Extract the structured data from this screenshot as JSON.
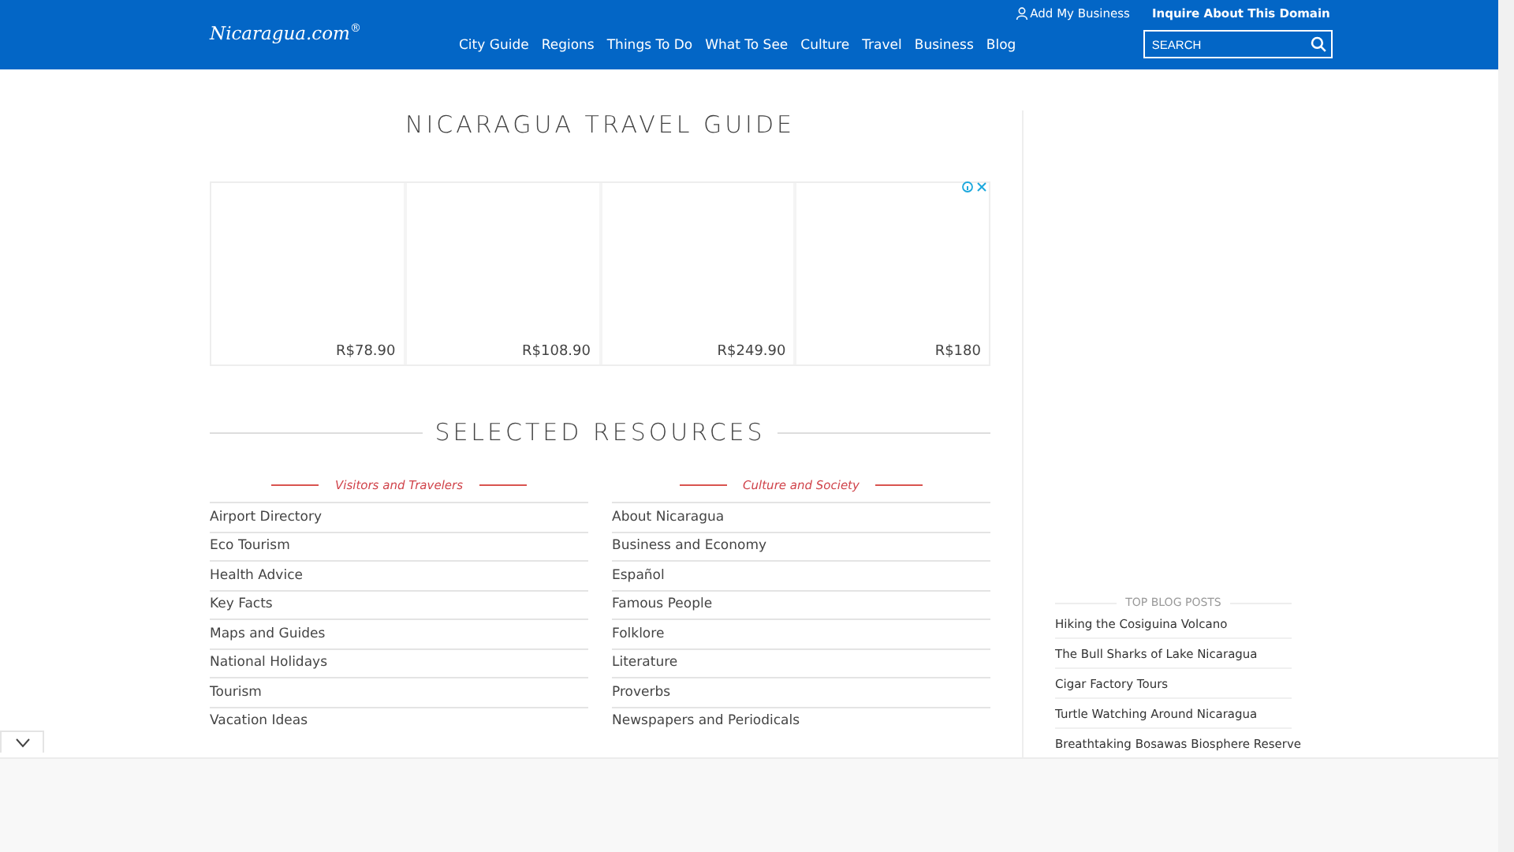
{
  "header": {
    "logo": "Nicaragua.com$^{®}$",
    "top_links": [
      {
        "kind": "user",
        "label": "Add My Business"
      },
      {
        "kind": "bold",
        "label": "Inquire About This Domain"
      }
    ],
    "nav": [
      "City Guide",
      "Regions",
      "Things To Do",
      "What To See",
      "Culture",
      "Travel",
      "Business",
      "Blog"
    ],
    "search": {
      "placeholder": "SEARCH"
    }
  },
  "page_title": "NICARAGUA TRAVEL GUIDE",
  "ad": {
    "prices": [
      "R$78.90",
      "R$108.90",
      "R$249.90",
      "R$180"
    ]
  },
  "resources": {
    "title": "SELECTED RESOURCES",
    "columns": [
      {
        "heading": "Visitors and Travelers",
        "links": [
          "Airport Directory",
          "Eco Tourism",
          "Health Advice",
          "Key Facts",
          "Maps and Guides",
          "National Holidays",
          "Tourism",
          "Vacation Ideas"
        ]
      },
      {
        "heading": "Culture and Society",
        "links": [
          "About Nicaragua",
          "Business and Economy",
          "Español",
          "Famous People",
          "Folklore",
          "Literature",
          "Proverbs",
          "Newspapers and Periodicals"
        ]
      }
    ]
  },
  "sidebar": {
    "heading": "TOP BLOG POSTS",
    "posts": [
      "Hiking the Cosiguina Volcano",
      "The Bull Sharks of Lake Nicaragua",
      "Cigar Factory Tours",
      "Turtle Watching Around Nicaragua",
      "Breathtaking Bosawas Biosphere Reserve"
    ]
  }
}
